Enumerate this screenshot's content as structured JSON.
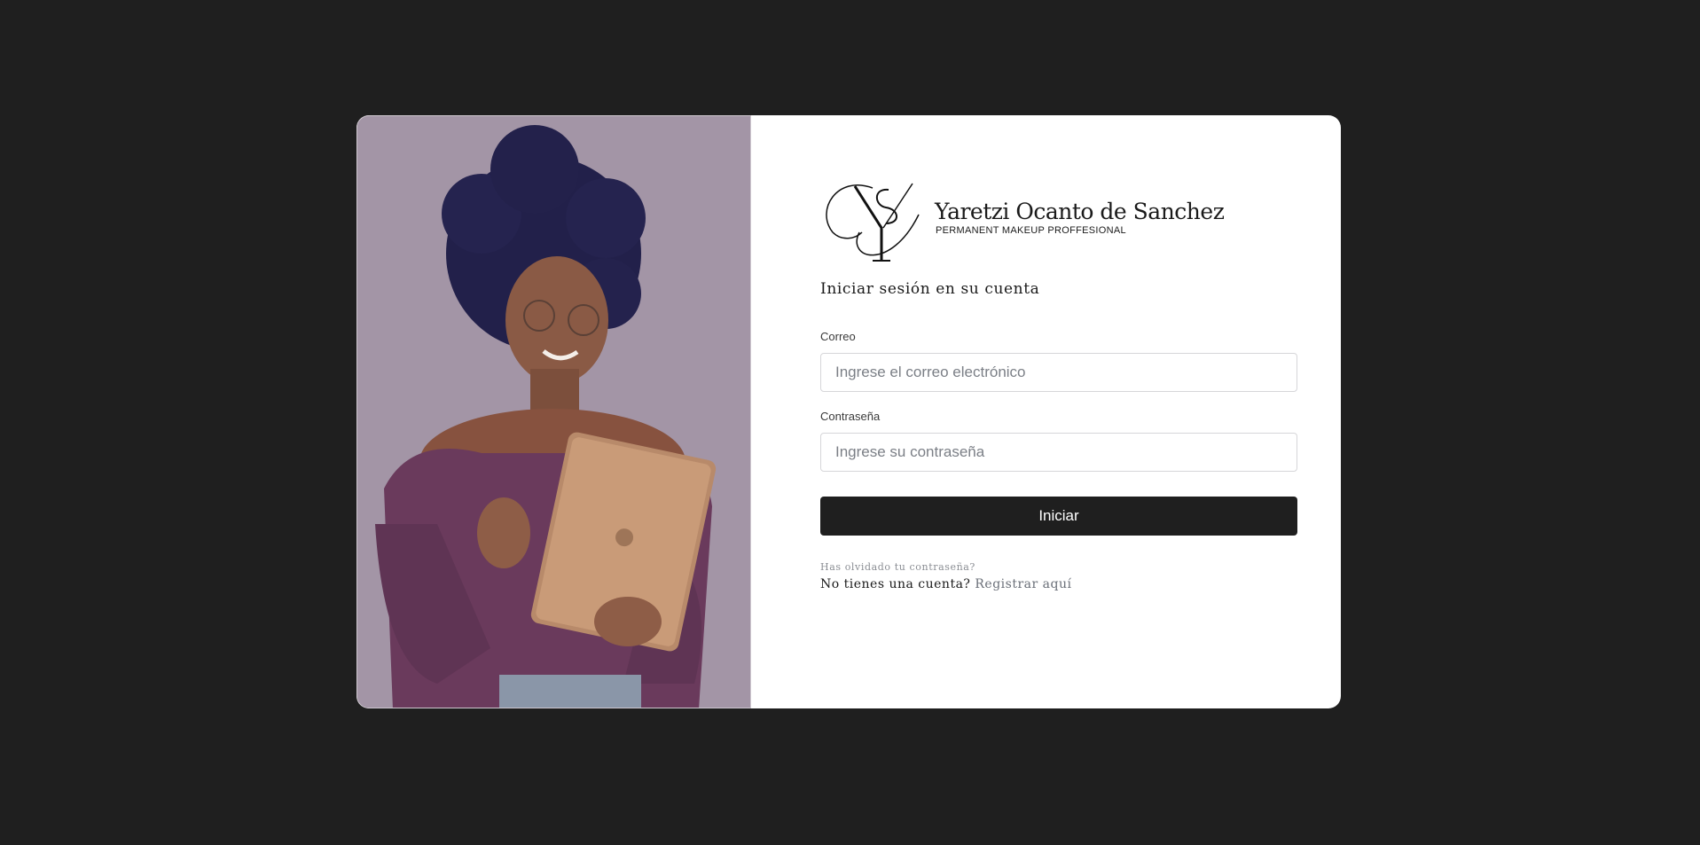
{
  "brand": {
    "name": "Yaretzi Ocanto de Sanchez",
    "tagline": "PERMANENT MAKEUP PROFFESIONAL",
    "monogram": "YS"
  },
  "login": {
    "heading": "Iniciar sesión en su cuenta",
    "email_label": "Correo",
    "email_placeholder": "Ingrese el correo electrónico",
    "email_value": "",
    "password_label": "Contraseña",
    "password_placeholder": "Ingrese su contraseña",
    "password_value": "",
    "submit_label": "Iniciar",
    "forgot_label": "Has olvidado tu contraseña?",
    "no_account_text": "No tienes una cuenta?",
    "register_label": "Registrar aquí"
  },
  "colors": {
    "page_background": "#1f1f1f",
    "card_background": "#ffffff",
    "button_background": "#1f1f1f",
    "button_text": "#ffffff",
    "muted_text": "#8a8d93"
  },
  "icons": {
    "photo": "woman-with-tablet-photo",
    "logo": "ys-monogram-logo"
  }
}
